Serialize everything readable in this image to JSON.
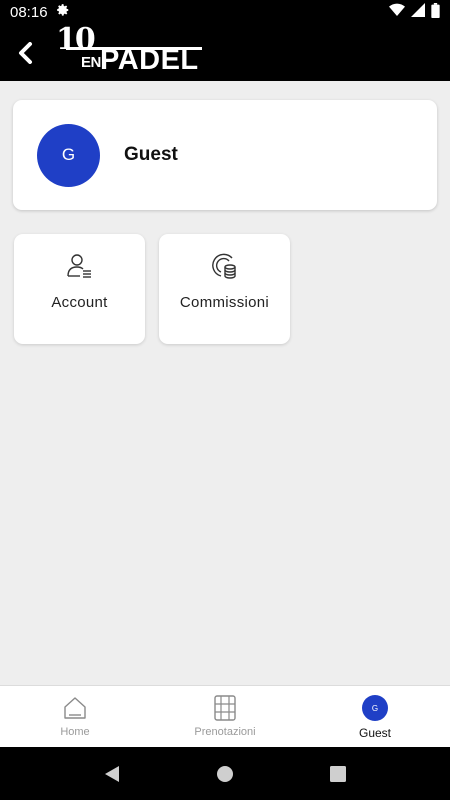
{
  "status_bar": {
    "time": "08:16",
    "icons": [
      "gear-icon",
      "wifi-icon",
      "signal-icon",
      "battery-icon"
    ]
  },
  "app_bar": {
    "back_icon": "back-arrow-icon",
    "logo": {
      "ten": "10",
      "en": "EN",
      "padel": "PADEL"
    }
  },
  "profile": {
    "initial": "G",
    "name": "Guest",
    "avatar_color": "#1f3fc6"
  },
  "tiles": [
    {
      "label": "Account",
      "icon": "account-icon"
    },
    {
      "label": "Commissioni",
      "icon": "coins-icon"
    }
  ],
  "bottom_nav": {
    "items": [
      {
        "label": "Home",
        "icon": "home-icon",
        "active": false
      },
      {
        "label": "Prenotazioni",
        "icon": "calendar-grid-icon",
        "active": false
      },
      {
        "label": "Guest",
        "icon": "avatar",
        "initial": "G",
        "active": true
      }
    ]
  },
  "system_nav": {
    "buttons": [
      "back-triangle-icon",
      "home-circle-icon",
      "recents-square-icon"
    ]
  },
  "colors": {
    "accent": "#1f3fc6",
    "background": "#eeeeee",
    "bar": "#000000"
  }
}
